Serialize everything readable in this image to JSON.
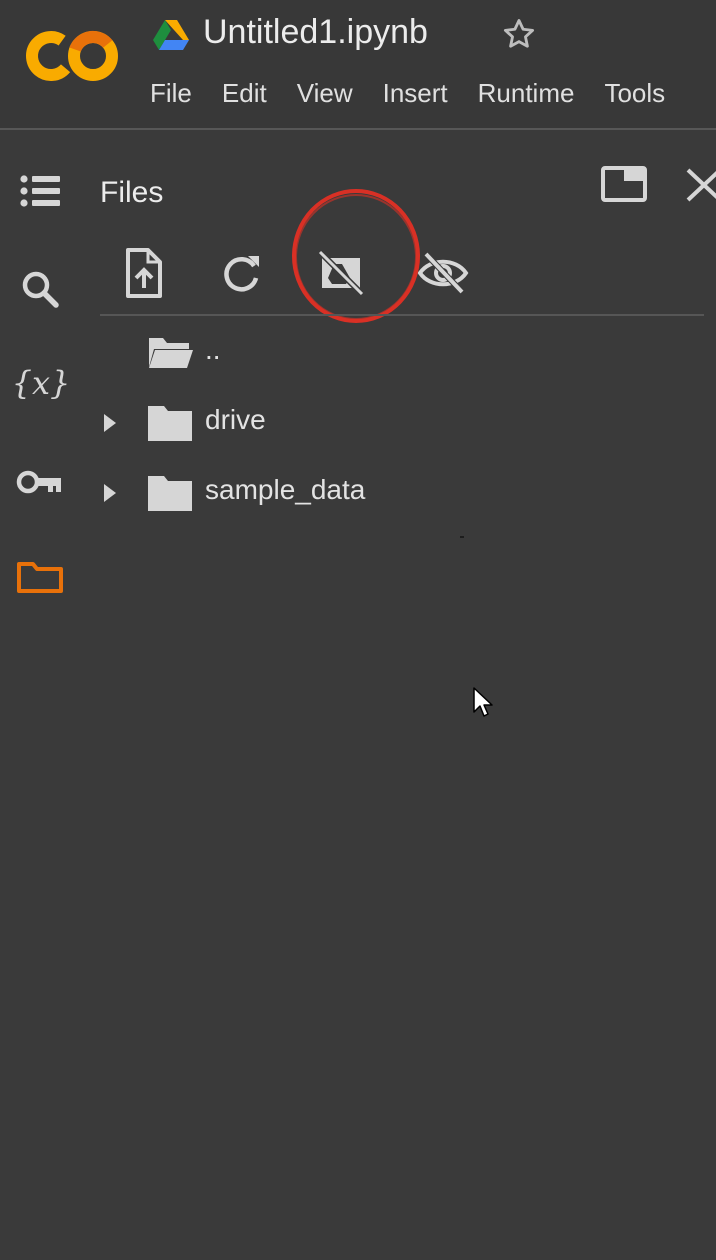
{
  "app": {
    "logo_text": "CO",
    "doc_title": "Untitled1.ipynb",
    "brand_color": "#f9ab00",
    "accent_orange": "#e8710a"
  },
  "menu": [
    "File",
    "Edit",
    "View",
    "Insert",
    "Runtime",
    "Tools"
  ],
  "sidebar": {
    "items": [
      {
        "icon": "table-of-contents-icon",
        "active": false
      },
      {
        "icon": "search-icon",
        "active": false
      },
      {
        "icon": "variables-icon",
        "active": false
      },
      {
        "icon": "key-icon",
        "active": false
      },
      {
        "icon": "folder-icon",
        "active": true
      }
    ]
  },
  "files_panel": {
    "title": "Files",
    "toolbar": [
      {
        "icon": "upload-file-icon"
      },
      {
        "icon": "refresh-icon"
      },
      {
        "icon": "unmount-drive-icon",
        "highlighted": true
      },
      {
        "icon": "hide-hidden-files-icon"
      }
    ],
    "tree": [
      {
        "name": "..",
        "expandable": false,
        "icon": "open-folder-icon"
      },
      {
        "name": "drive",
        "expandable": true,
        "icon": "folder-icon"
      },
      {
        "name": "sample_data",
        "expandable": true,
        "icon": "folder-icon"
      }
    ]
  },
  "colors": {
    "background": "#3a3a3a",
    "highlight_circle": "#d93025"
  }
}
